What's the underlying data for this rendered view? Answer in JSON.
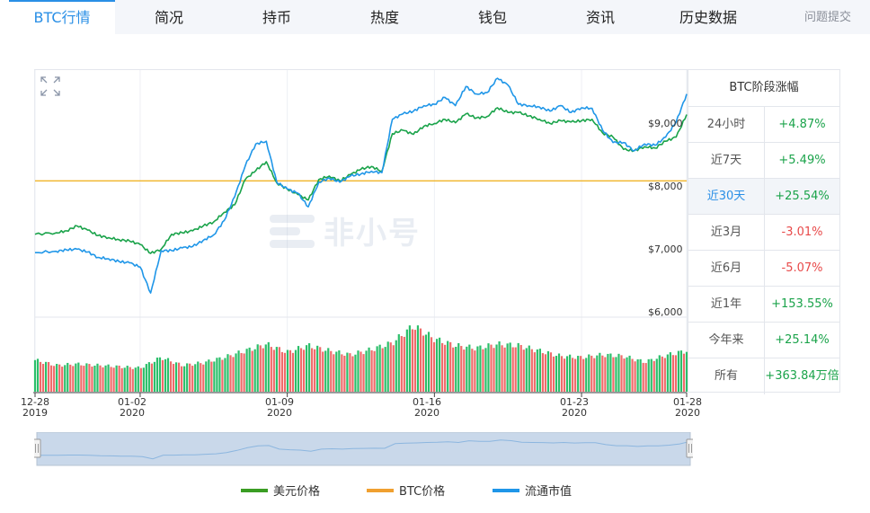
{
  "tabs": [
    {
      "label": "BTC行情",
      "active": true
    },
    {
      "label": "简况"
    },
    {
      "label": "持币"
    },
    {
      "label": "热度"
    },
    {
      "label": "钱包"
    },
    {
      "label": "资讯"
    },
    {
      "label": "历史数据"
    },
    {
      "label": "问题提交"
    }
  ],
  "stats": {
    "title": "BTC阶段涨幅",
    "rows": [
      {
        "label": "24小时",
        "value": "+4.87%",
        "dir": "up"
      },
      {
        "label": "近7天",
        "value": "+5.49%",
        "dir": "up"
      },
      {
        "label": "近30天",
        "value": "+25.54%",
        "dir": "up",
        "selected": true
      },
      {
        "label": "近3月",
        "value": "-3.01%",
        "dir": "down"
      },
      {
        "label": "近6月",
        "value": "-5.07%",
        "dir": "down"
      },
      {
        "label": "近1年",
        "value": "+153.55%",
        "dir": "up"
      },
      {
        "label": "今年来",
        "value": "+25.14%",
        "dir": "up"
      },
      {
        "label": "所有",
        "value": "+363.84万倍",
        "dir": "up"
      }
    ]
  },
  "watermark": "非小号",
  "legend": [
    {
      "label": "美元价格",
      "color": "#3a9d23"
    },
    {
      "label": "BTC价格",
      "color": "#f0a030"
    },
    {
      "label": "流通市值",
      "color": "#1f96e8"
    }
  ],
  "colors": {
    "accent": "#2a8fe6",
    "up": "#1aa34a",
    "down": "#e84a4a",
    "bar_up": "#2bbf6a",
    "bar_down": "#f06a6a"
  },
  "chart_data": {
    "type": "line",
    "ylabels": [
      "$9,000",
      "$8,000",
      "$7,000",
      "$6,000"
    ],
    "yticks": [
      9000,
      8000,
      7000,
      6000
    ],
    "ylim": [
      6000,
      9600
    ],
    "x_tick_labels": [
      {
        "date": "12-28",
        "year": "2019",
        "day": 0
      },
      {
        "date": "01-02",
        "year": "2020",
        "day": 5
      },
      {
        "date": "01-09",
        "year": "2020",
        "day": 12
      },
      {
        "date": "01-16",
        "year": "2020",
        "day": 19
      },
      {
        "date": "01-23",
        "year": "2020",
        "day": 26
      },
      {
        "date": "01-28",
        "year": "2020",
        "day": 31
      }
    ],
    "xlim": [
      0,
      31
    ],
    "btc_reference": 7980,
    "series": [
      {
        "name": "美元价格",
        "x": [
          0,
          1,
          1.5,
          2,
          2.5,
          3,
          3.5,
          4,
          4.5,
          5,
          5.5,
          6,
          6.5,
          7,
          7.5,
          8,
          8.5,
          9,
          9.5,
          10,
          10.5,
          11,
          11.5,
          12,
          12.5,
          13,
          13.5,
          14,
          14.5,
          15,
          15.5,
          16,
          16.5,
          17,
          17.5,
          18,
          18.5,
          19,
          19.5,
          20,
          20.5,
          21,
          21.5,
          22,
          22.5,
          23,
          23.5,
          24,
          24.5,
          25,
          25.5,
          26,
          26.5,
          27,
          27.5,
          28,
          28.5,
          29,
          29.5,
          30,
          30.5,
          31
        ],
        "y": [
          7200,
          7220,
          7250,
          7320,
          7260,
          7180,
          7150,
          7120,
          7100,
          7050,
          6920,
          6980,
          7200,
          7220,
          7250,
          7320,
          7380,
          7520,
          7630,
          8000,
          8130,
          8260,
          7950,
          7860,
          7780,
          7700,
          8000,
          8050,
          7980,
          8070,
          8150,
          8190,
          8120,
          8670,
          8720,
          8660,
          8780,
          8820,
          8880,
          8830,
          8960,
          8900,
          8920,
          9050,
          8980,
          8980,
          8930,
          8880,
          8820,
          8860,
          8840,
          8860,
          8880,
          8680,
          8620,
          8440,
          8420,
          8480,
          8460,
          8560,
          8620,
          8950
        ]
      },
      {
        "name": "流通市值",
        "x": [
          0,
          1,
          1.5,
          2,
          2.5,
          3,
          3.5,
          4,
          4.5,
          5,
          5.5,
          6,
          6.5,
          7,
          7.5,
          8,
          8.5,
          9,
          9.5,
          10,
          10.5,
          11,
          11.5,
          12,
          12.5,
          13,
          13.5,
          14,
          14.5,
          15,
          15.5,
          16,
          16.5,
          17,
          17.5,
          18,
          18.5,
          19,
          19.5,
          20,
          20.5,
          21,
          21.5,
          22,
          22.5,
          23,
          23.5,
          24,
          24.5,
          25,
          25.5,
          26,
          26.5,
          27,
          27.5,
          28,
          28.5,
          29,
          29.5,
          30,
          30.5,
          31
        ],
        "y": [
          6930,
          6950,
          6970,
          6980,
          6940,
          6860,
          6840,
          6800,
          6780,
          6720,
          6340,
          6960,
          6960,
          7000,
          7020,
          7110,
          7190,
          7400,
          7750,
          8200,
          8520,
          8560,
          7960,
          7860,
          7800,
          7600,
          7960,
          8020,
          7960,
          8050,
          8080,
          8120,
          8100,
          8880,
          8960,
          9000,
          9080,
          9100,
          9200,
          9080,
          9360,
          9250,
          9270,
          9480,
          9380,
          9100,
          9080,
          9060,
          9000,
          9080,
          8980,
          9050,
          9040,
          8720,
          8540,
          8540,
          8420,
          8520,
          8500,
          8620,
          8840,
          9250
        ]
      }
    ],
    "volume": {
      "x": [
        0,
        1,
        2,
        3,
        4,
        5,
        6,
        7,
        8,
        9,
        10,
        11,
        12,
        13,
        14,
        15,
        16,
        17,
        18,
        19,
        20,
        21,
        22,
        23,
        24,
        25,
        26,
        27,
        28,
        29,
        30,
        31
      ],
      "values": [
        0.48,
        0.4,
        0.42,
        0.4,
        0.38,
        0.36,
        0.52,
        0.4,
        0.44,
        0.52,
        0.62,
        0.72,
        0.6,
        0.7,
        0.62,
        0.56,
        0.64,
        0.74,
        1.0,
        0.8,
        0.7,
        0.66,
        0.72,
        0.7,
        0.62,
        0.54,
        0.52,
        0.56,
        0.54,
        0.45,
        0.55,
        0.62
      ]
    }
  }
}
